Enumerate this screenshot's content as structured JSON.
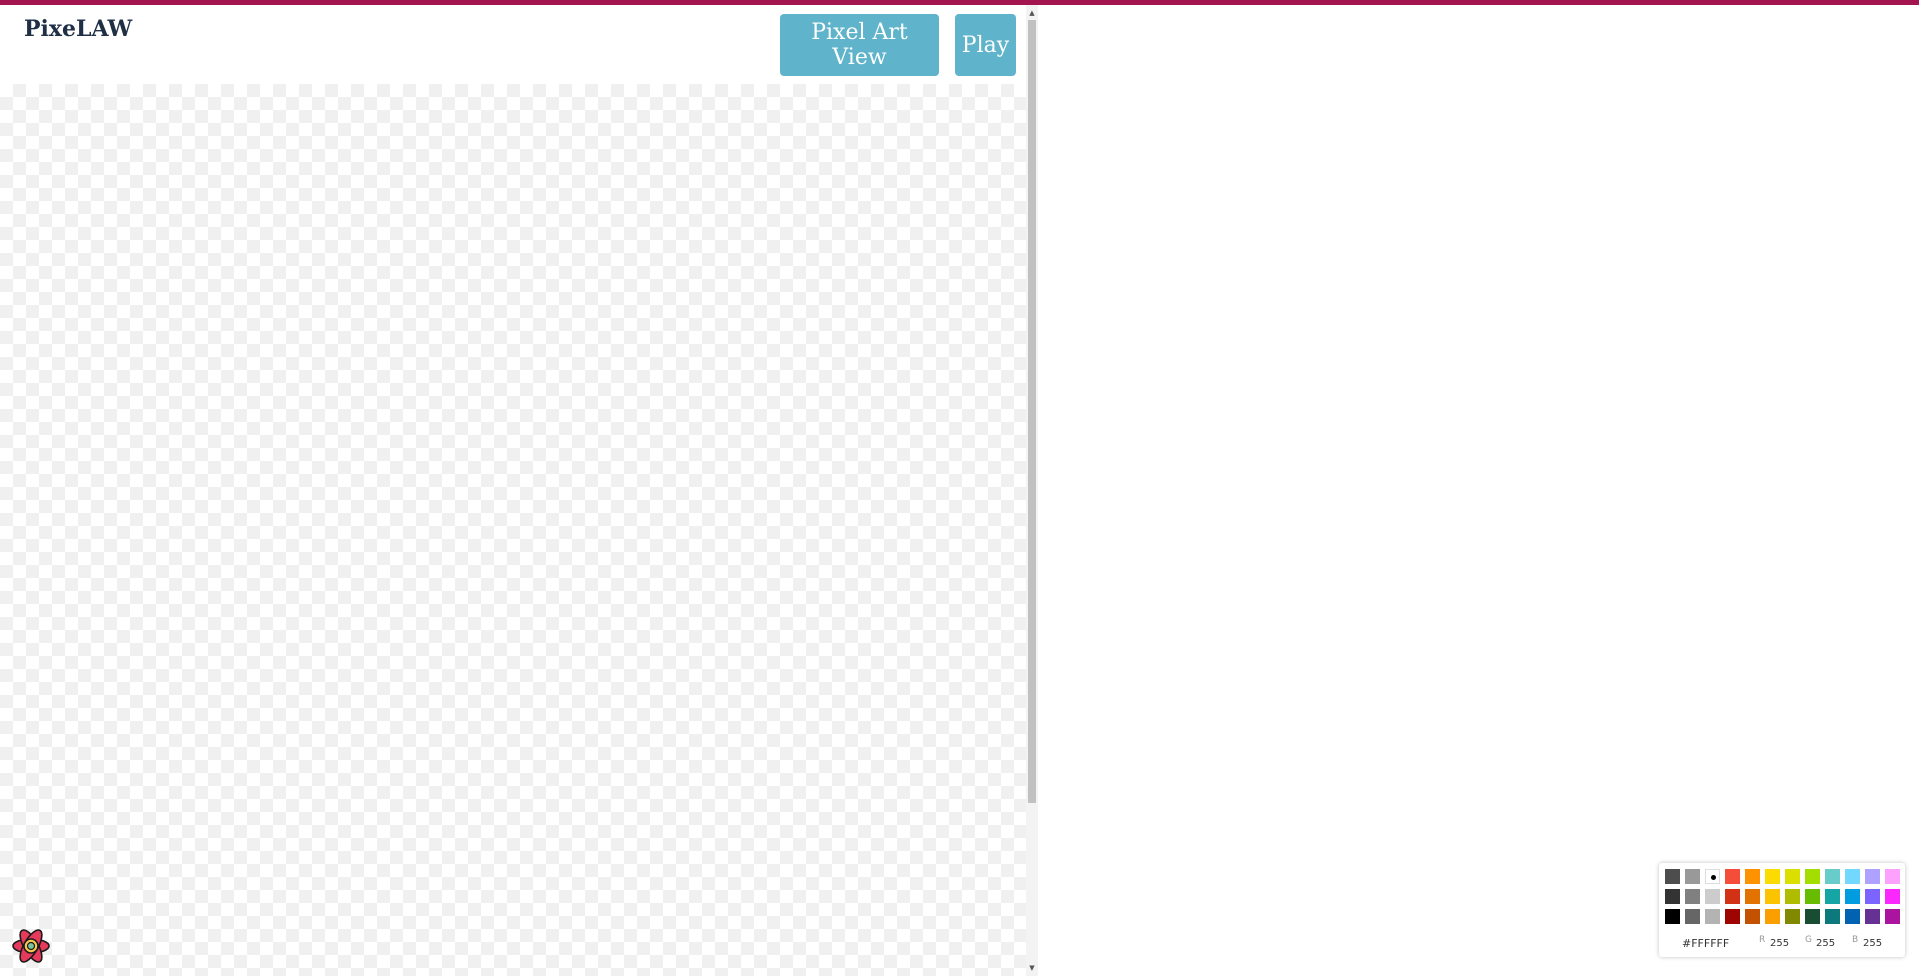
{
  "header": {
    "title": "PixeLAW",
    "buttons": {
      "pixel_art_view": "Pixel Art View",
      "play": "Play"
    }
  },
  "icons": {
    "scroll_up": "up-arrow-icon",
    "scroll_down": "down-arrow-icon",
    "react_logo": "react-logo-icon"
  },
  "colors": {
    "accent_top_bar": "#a3154f",
    "button": "#5fb3ca",
    "title": "#1f2f45"
  },
  "color_picker": {
    "swatch_rows": [
      [
        "#4d4d4d",
        "#999999",
        "#ffffff",
        "#f44e3b",
        "#fe9200",
        "#fcdc00",
        "#dbdf00",
        "#a4dd00",
        "#68ccca",
        "#73d8ff",
        "#aea1ff",
        "#fda1ff"
      ],
      [
        "#333333",
        "#808080",
        "#cccccc",
        "#d33115",
        "#e27300",
        "#fcc400",
        "#b0bc00",
        "#68bc00",
        "#16a5a5",
        "#009ce0",
        "#7b64ff",
        "#fa28ff"
      ],
      [
        "#000000",
        "#666666",
        "#b3b3b3",
        "#9f0500",
        "#c45100",
        "#fb9e00",
        "#808900",
        "#194d33",
        "#0c797d",
        "#0062b1",
        "#653294",
        "#ab149e"
      ]
    ],
    "selected_color": "#ffffff",
    "hex": "#FFFFFF",
    "channels": {
      "r_label": "R",
      "r_value": "255",
      "g_label": "G",
      "g_value": "255",
      "b_label": "B",
      "b_value": "255"
    }
  }
}
